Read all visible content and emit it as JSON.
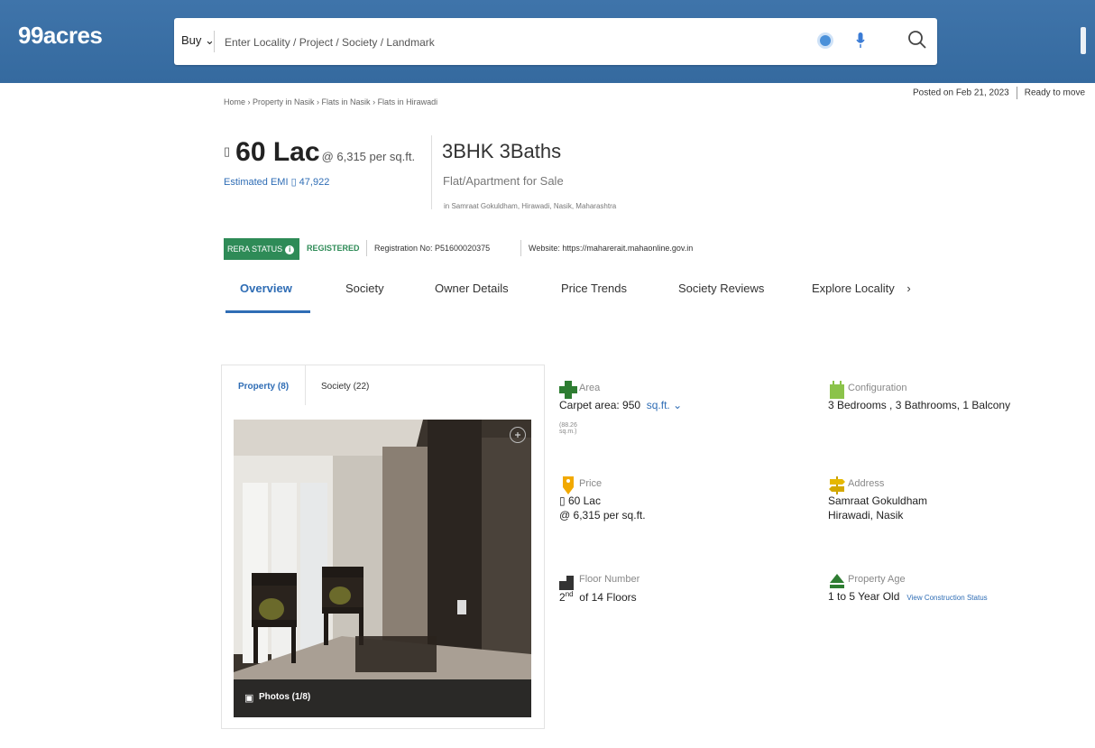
{
  "header": {
    "logo": "99acres",
    "buy_label": "Buy",
    "search_placeholder": "Enter Locality / Project / Society / Landmark"
  },
  "breadcrumb": [
    "Home",
    "Property in Nasik",
    "Flats in Nasik",
    "Flats in Hirawadi"
  ],
  "posted": {
    "date": "Posted on Feb 21, 2023",
    "status": "Ready to move"
  },
  "summary": {
    "price": "60 Lac",
    "per_sqft": "@ 6,315 per sq.ft.",
    "emi": "Estimated EMI ▯ 47,922",
    "config": "3BHK 3Baths",
    "type": "Flat/Apartment for Sale",
    "location": "in Samraat Gokuldham, Hirawadi, Nasik, Maharashtra"
  },
  "rera": {
    "badge": "RERA STATUS",
    "status": "REGISTERED",
    "reg_no": "Registration No: P51600020375",
    "website": "Website: https://maharerait.mahaonline.gov.in"
  },
  "tabs": [
    "Overview",
    "Society",
    "Owner Details",
    "Price Trends",
    "Society Reviews",
    "Explore Locality"
  ],
  "gallery": {
    "tab_property": "Property (8)",
    "tab_society": "Society (22)",
    "photos_label": "Photos (1/8)"
  },
  "details": {
    "area": {
      "label": "Area",
      "value": "Carpet area: 950",
      "unit": "sq.ft.",
      "sub": "(88.26 sq.m.)"
    },
    "configuration": {
      "label": "Configuration",
      "value": "3 Bedrooms , 3 Bathrooms, 1 Balcony"
    },
    "price": {
      "label": "Price",
      "value": "▯ 60 Lac",
      "value2": "@ 6,315 per sq.ft."
    },
    "address": {
      "label": "Address",
      "value": "Samraat Gokuldham",
      "value2": "Hirawadi, Nasik"
    },
    "floor": {
      "label": "Floor Number",
      "floor": "2",
      "suffix": "nd",
      "total": "of 14 Floors"
    },
    "age": {
      "label": "Property Age",
      "value": "1 to 5 Year Old",
      "link": "View Construction Status"
    }
  },
  "colors": {
    "header": "#3c6ea2",
    "accent": "#2f6db5",
    "rera_green": "#2e8b57"
  }
}
